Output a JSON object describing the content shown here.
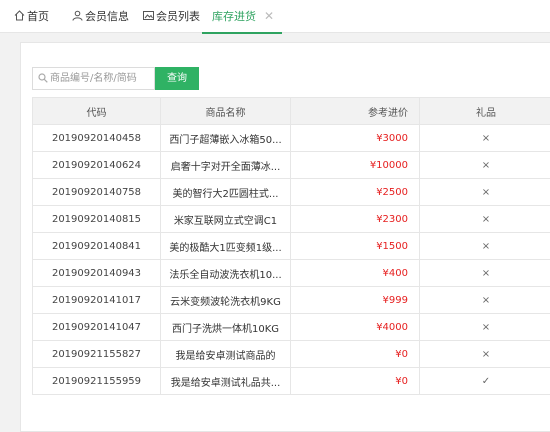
{
  "tabs": [
    {
      "label": "首页",
      "icon": "home-icon"
    },
    {
      "label": "会员信息",
      "icon": "user-icon"
    },
    {
      "label": "会员列表",
      "icon": "image-icon"
    },
    {
      "label": "库存进货",
      "active": true,
      "closable": true
    }
  ],
  "search": {
    "placeholder": "商品编号/名称/简码",
    "value": "",
    "button_label": "查询"
  },
  "table": {
    "headers": [
      "代码",
      "商品名称",
      "参考进价",
      "礼品"
    ],
    "rows": [
      {
        "code": "20190920140458",
        "name": "西门子超薄嵌入冰箱50...",
        "price": "¥3000",
        "gift": "×"
      },
      {
        "code": "20190920140624",
        "name": "启奢十字对开全面薄冰...",
        "price": "¥10000",
        "gift": "×"
      },
      {
        "code": "20190920140758",
        "name": "美的智行大2匹圆柱式...",
        "price": "¥2500",
        "gift": "×"
      },
      {
        "code": "20190920140815",
        "name": "米家互联网立式空调C1",
        "price": "¥2300",
        "gift": "×"
      },
      {
        "code": "20190920140841",
        "name": "美的极酷大1匹变频1级...",
        "price": "¥1500",
        "gift": "×"
      },
      {
        "code": "20190920140943",
        "name": "法乐全自动波洗衣机10...",
        "price": "¥400",
        "gift": "×"
      },
      {
        "code": "20190920141017",
        "name": "云米变频波轮洗衣机9KG",
        "price": "¥999",
        "gift": "×"
      },
      {
        "code": "20190920141047",
        "name": "西门子洗烘一体机10KG",
        "price": "¥4000",
        "gift": "×"
      },
      {
        "code": "20190921155827",
        "name": "我是给安卓测试商品的",
        "price": "¥0",
        "gift": "×"
      },
      {
        "code": "20190921155959",
        "name": "我是给安卓测试礼品共...",
        "price": "¥0",
        "gift": "✓"
      }
    ]
  },
  "colors": {
    "accent": "#2fa360",
    "button": "#2fb264",
    "price": "#e62020"
  }
}
